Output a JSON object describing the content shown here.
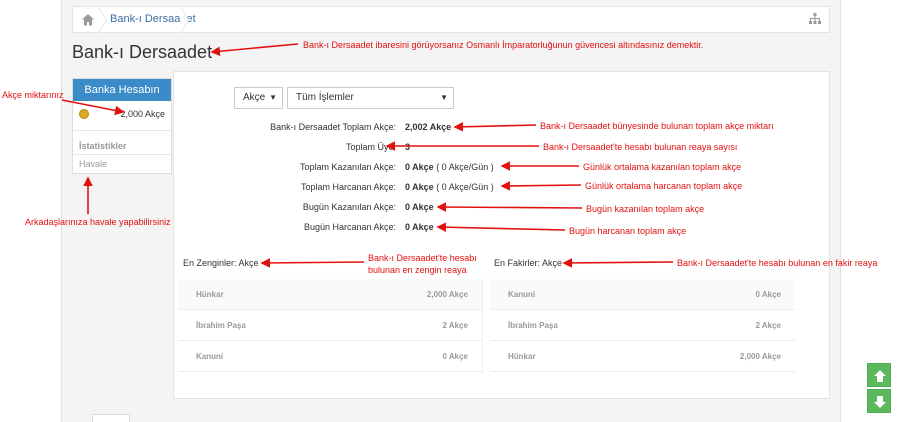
{
  "breadcrumb": {
    "home_icon": "home-icon",
    "current": "Bank-ı Dersaadet",
    "right_icon": "sitemap-icon"
  },
  "page": {
    "title": "Bank-ı Dersaadet"
  },
  "sidebar": {
    "header": "Banka Hesabın",
    "coin_icon": "coin-icon",
    "amount": "2,000 Akçe",
    "stats_label": "İstatistikler",
    "havale": "Havale"
  },
  "filters": {
    "currency": "Akçe",
    "transactions": "Tüm İşlemler"
  },
  "stats": [
    {
      "label": "Bank-ı Dersaadet Toplam Akçe:",
      "value": "2,002 Akçe",
      "extra": ""
    },
    {
      "label": "Toplam Üye:",
      "value": "3",
      "extra": ""
    },
    {
      "label": "Toplam Kazanılan Akçe:",
      "value": "0 Akçe",
      "extra": " ( 0 Akçe/Gün )"
    },
    {
      "label": "Toplam Harcanan Akçe:",
      "value": "0 Akçe",
      "extra": " ( 0 Akçe/Gün )"
    },
    {
      "label": "Bugün Kazanılan Akçe:",
      "value": "0 Akçe",
      "extra": ""
    },
    {
      "label": "Bugün Harcanan Akçe:",
      "value": "0 Akçe",
      "extra": ""
    }
  ],
  "rich": {
    "label": "En Zenginler: Akçe",
    "rows": [
      {
        "name": "Hünkar",
        "amount": "2,000 Akçe"
      },
      {
        "name": "İbrahim Paşa",
        "amount": "2 Akçe"
      },
      {
        "name": "Kanuni",
        "amount": "0 Akçe"
      }
    ]
  },
  "poor": {
    "label": "En Fakirler: Akçe",
    "rows": [
      {
        "name": "Kanuni",
        "amount": "0 Akçe"
      },
      {
        "name": "İbrahim Paşa",
        "amount": "2 Akçe"
      },
      {
        "name": "Hünkar",
        "amount": "2,000 Akçe"
      }
    ]
  },
  "annotations": {
    "title": "Bank-ı Dersaadet ibaresini görüyorsanız Osmanlı İmparatorluğunun güvencesi altındasınız demektir.",
    "akce": "Akçe miktarınız",
    "havale": "Arkadaşlarınıza havale yapabilirsiniz",
    "total": "Bank-ı Dersaadet bünyesinde bulunan toplam akçe miktarı",
    "members": "Bank-ı Dersaadet'te hesabı bulunan reaya sayısı",
    "avg_earned": "Günlük ortalama kazanılan toplam akçe",
    "avg_spent": "Günlük ortalama harcanan toplam akçe",
    "today_earned": "Bugün kazanılan toplam akçe",
    "today_spent": "Bugün harcanan toplam akçe",
    "richest_1": "Bank-ı Dersaadet'te hesabı",
    "richest_2": "bulunan en zengin reaya",
    "poorest": "Bank-ı Dersaadet'te hesabı bulunan en fakir reaya"
  },
  "colors": {
    "accent": "#3a8bc7",
    "annotation": "#e31010",
    "scroll": "#5cb85c"
  }
}
